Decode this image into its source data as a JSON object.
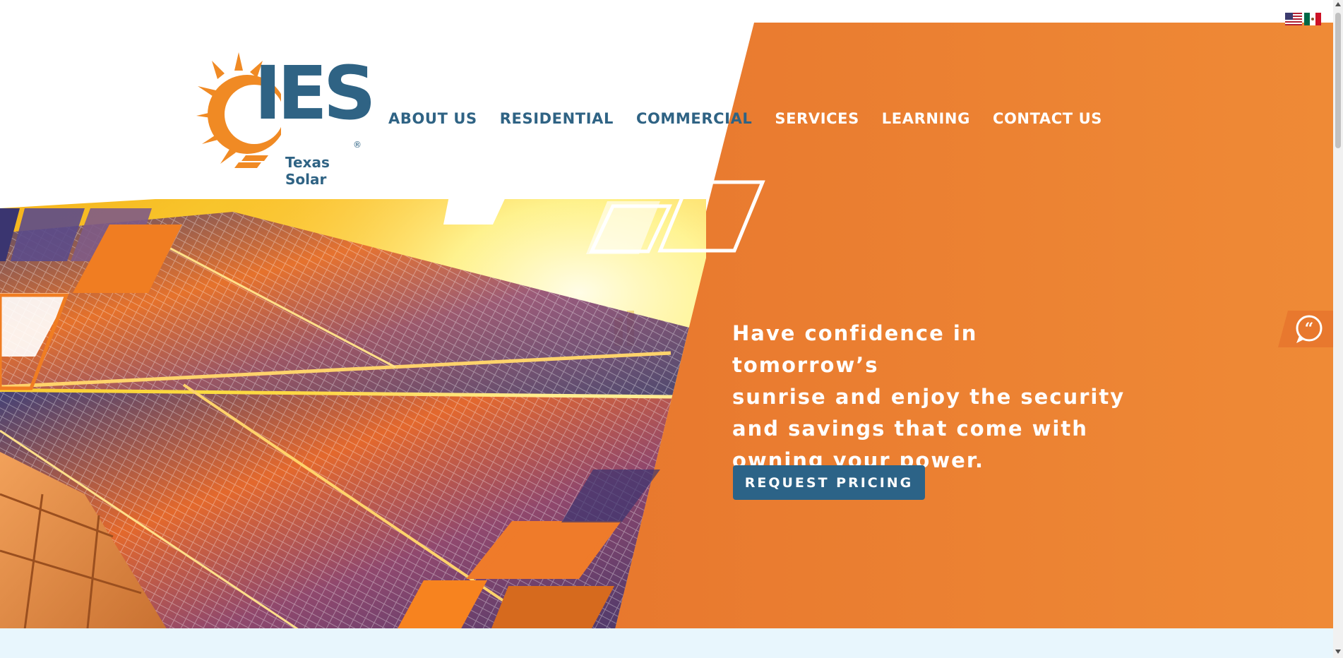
{
  "brand": {
    "logo_main": "IES",
    "logo_sub": "Texas Solar",
    "logo_reg": "®"
  },
  "nav": {
    "items": [
      {
        "label": "ABOUT US"
      },
      {
        "label": "RESIDENTIAL"
      },
      {
        "label": "COMMERCIAL"
      },
      {
        "label": "SERVICES"
      },
      {
        "label": "LEARNING"
      },
      {
        "label": "CONTACT US"
      }
    ]
  },
  "hero": {
    "headline_lines": [
      "Have confidence in tomorrow’s",
      "sunrise and enjoy the security",
      "and savings that come with",
      "owning your power."
    ],
    "cta_label": "REQUEST PRICING"
  },
  "language": {
    "flags": [
      "us-flag-icon",
      "mexico-flag-icon"
    ]
  },
  "chat": {
    "icon": "quote-chat-icon"
  },
  "colors": {
    "orange": "#ec7c31",
    "navy": "#2f6384",
    "cta_bg": "#2c6387",
    "panel_blue": "#e8f6fd"
  }
}
